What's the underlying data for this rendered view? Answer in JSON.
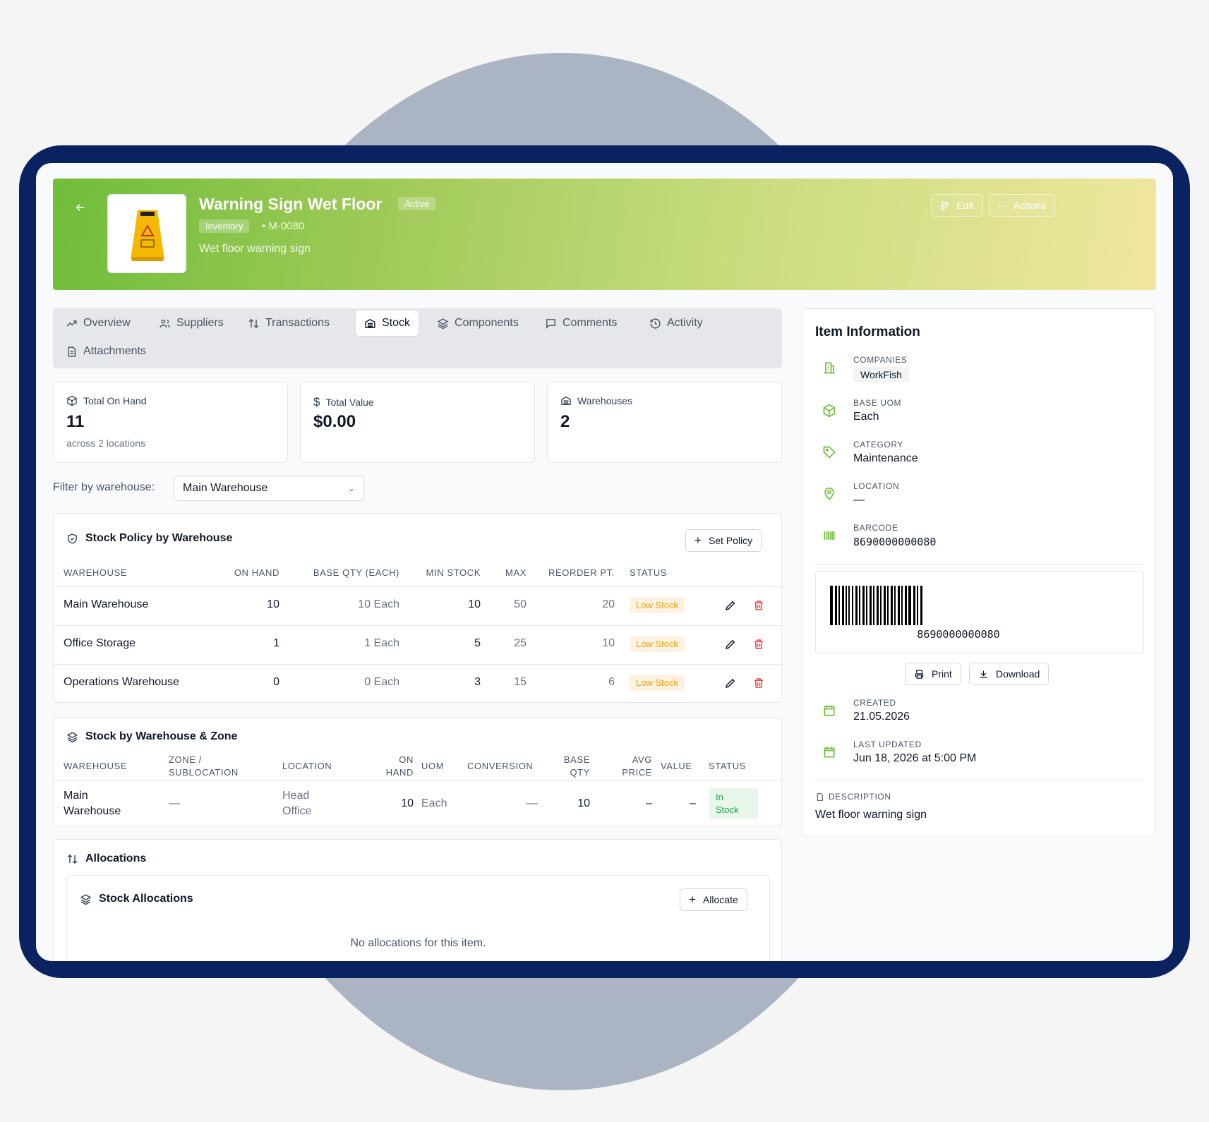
{
  "header": {
    "title": "Warning Sign Wet Floor",
    "status": "Active",
    "category_pill": "Inventory",
    "code": "• M-0080",
    "subtitle": "Wet floor warning sign",
    "edit_label": "Edit",
    "actions_label": "Actions"
  },
  "tabs": [
    "Overview",
    "Suppliers",
    "Transactions",
    "Stock",
    "Components",
    "Comments",
    "Activity",
    "Attachments"
  ],
  "active_tab": "Stock",
  "stats": {
    "on_hand": {
      "label": "Total On Hand",
      "value": "11",
      "sub": "across 2 locations"
    },
    "value": {
      "label": "Total Value",
      "value": "$0.00"
    },
    "warehouses": {
      "label": "Warehouses",
      "value": "2"
    }
  },
  "filter": {
    "label": "Filter by warehouse:",
    "value": "Main Warehouse"
  },
  "policy": {
    "title": "Stock Policy by Warehouse",
    "set_policy": "Set Policy",
    "columns": [
      "Warehouse",
      "On Hand",
      "Base Qty (Each)",
      "Min Stock",
      "Max",
      "Reorder Pt.",
      "Status"
    ],
    "rows": [
      {
        "warehouse": "Main Warehouse",
        "on_hand": "10",
        "base_qty": "10 Each",
        "min": "10",
        "max": "50",
        "reorder": "20",
        "status": "Low Stock"
      },
      {
        "warehouse": "Office Storage",
        "on_hand": "1",
        "base_qty": "1 Each",
        "min": "5",
        "max": "25",
        "reorder": "10",
        "status": "Low Stock"
      },
      {
        "warehouse": "Operations Warehouse",
        "on_hand": "0",
        "base_qty": "0 Each",
        "min": "3",
        "max": "15",
        "reorder": "6",
        "status": "Low Stock"
      }
    ]
  },
  "zone": {
    "title": "Stock by Warehouse & Zone",
    "columns": {
      "warehouse": "Warehouse",
      "zone_1": "Zone /",
      "zone_2": "Sublocation",
      "location": "Location",
      "on_hand_1": "On",
      "on_hand_2": "Hand",
      "uom": "UOM",
      "conversion": "Conversion",
      "base_qty_1": "Base",
      "base_qty_2": "Qty",
      "avg_price_1": "Avg",
      "avg_price_2": "Price",
      "value": "Value",
      "status": "Status"
    },
    "row": {
      "warehouse_1": "Main",
      "warehouse_2": "Warehouse",
      "zone": "—",
      "location_1": "Head",
      "location_2": "Office",
      "on_hand": "10",
      "uom": "Each",
      "conversion": "—",
      "base_qty": "10",
      "avg_price": "–",
      "value": "–",
      "status_1": "In",
      "status_2": "Stock"
    }
  },
  "allocations": {
    "title": "Allocations",
    "sub_title": "Stock Allocations",
    "allocate": "Allocate",
    "empty": "No allocations for this item."
  },
  "item_info": {
    "title": "Item Information",
    "companies_label": "Companies",
    "company": "WorkFish",
    "base_uom_label": "Base UOM",
    "base_uom": "Each",
    "category_label": "Category",
    "category": "Maintenance",
    "location_label": "Location",
    "location": "—",
    "barcode_label": "Barcode",
    "barcode": "8690000000080",
    "print": "Print",
    "download": "Download",
    "created_label": "Created",
    "created": "21.05.2026",
    "updated_label": "Last Updated",
    "updated": "Jun 18, 2026 at 5:00 PM",
    "description_label": "Description",
    "description": "Wet floor warning sign"
  },
  "colors": {
    "accent": "#6fbd3a",
    "device": "#0b2261",
    "low_stock": "#f59e0b",
    "in_stock": "#16a34a",
    "delete": "#ef4444"
  }
}
